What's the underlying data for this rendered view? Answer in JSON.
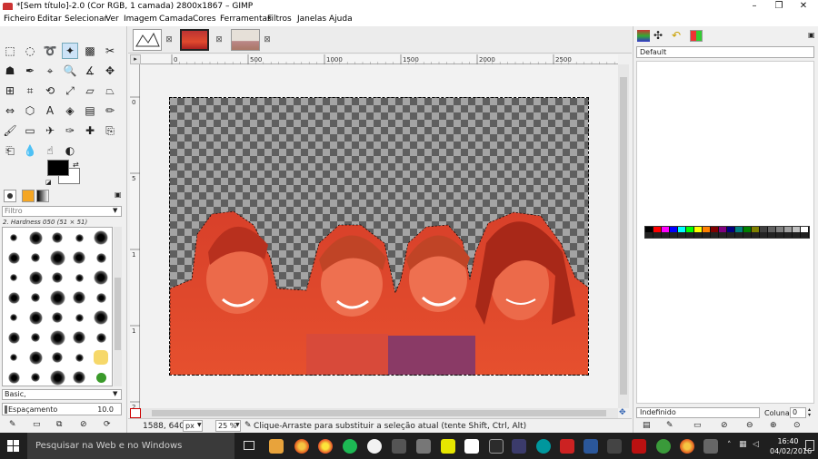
{
  "window": {
    "title": "*[Sem título]-2.0 (Cor RGB, 1 camada) 2800x1867 – GIMP",
    "minimize": "–",
    "maximize": "❐",
    "close": "✕"
  },
  "menubar": {
    "items": [
      "Ficheiro",
      "Editar",
      "Selecionar",
      "Ver",
      "Imagem",
      "Camada",
      "Cores",
      "Ferramentas",
      "Filtros",
      "Janelas",
      "Ajuda"
    ]
  },
  "toolbox": {
    "tools": [
      [
        "rect-select",
        "ellipse-select",
        "lasso-select",
        "fuzzy-select",
        "select-by-color",
        "scissors-select"
      ],
      [
        "foreground-select",
        "paths-tool",
        "color-picker",
        "zoom-tool",
        "measure-tool",
        "move-tool"
      ],
      [
        "align-tool",
        "crop-tool",
        "rotate-tool",
        "scale-tool",
        "shear-tool",
        "perspective-tool"
      ],
      [
        "flip-tool",
        "cage-tool",
        "text-tool",
        "bucket-fill",
        "gradient-tool",
        "pencil-tool"
      ],
      [
        "paintbrush",
        "eraser",
        "airbrush",
        "ink-tool",
        "heal-tool",
        "clone-tool"
      ],
      [
        "perspective-clone",
        "blur-tool",
        "smudge-tool",
        "dodge-burn-tool"
      ]
    ],
    "brush_filter_placeholder": "Filtro",
    "brush_name": "2. Hardness 050 (51 × 51)",
    "preset_label": "Basic,",
    "spacing_label": "Espaçamento",
    "spacing_value": "10.0"
  },
  "ruler": {
    "h_ticks": [
      "0",
      "500",
      "1000",
      "1500",
      "2000",
      "2500"
    ],
    "v_ticks": [
      "0",
      "5",
      "1",
      "1",
      "2"
    ]
  },
  "rightpanel": {
    "palette_name": "Default",
    "palette_mode": "Indefinido",
    "columns_label": "Colunas:",
    "columns_value": "0"
  },
  "palette_colors": [
    "#000000",
    "#ff0000",
    "#ff00ff",
    "#0000ff",
    "#00ffff",
    "#00ff00",
    "#ffff00",
    "#ff8000",
    "#800000",
    "#800080",
    "#000080",
    "#008080",
    "#008000",
    "#808000",
    "#404040",
    "#606060",
    "#808080",
    "#a0a0a0",
    "#c0c0c0",
    "#ffffff"
  ],
  "statusbar": {
    "coords": "1588, 640",
    "unit": "px",
    "zoom": "25 %",
    "message": "Clique-Arraste para substituir a seleção atual (tente Shift, Ctrl, Alt)"
  },
  "taskbar": {
    "search_placeholder": "Pesquisar na Web e no Windows",
    "time": "16:40",
    "date": "04/02/2016"
  },
  "colors": {
    "accent": "#cde3f7",
    "foreground": "#000000",
    "background": "#ffffff",
    "selection_tint": "#e64a2e"
  }
}
